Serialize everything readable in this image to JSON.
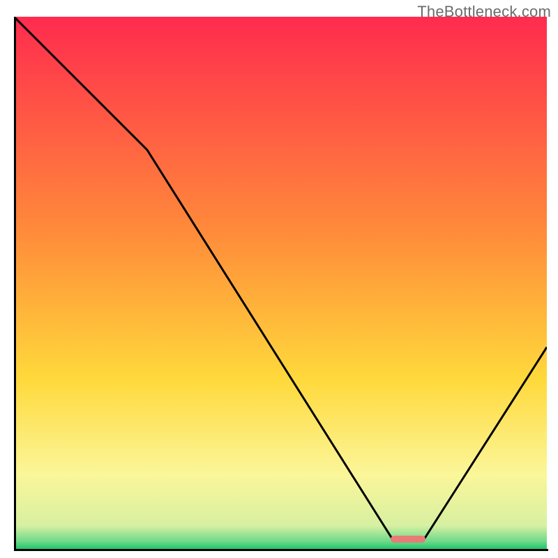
{
  "watermark": "TheBottleneck.com",
  "chart_data": {
    "type": "line",
    "title": "",
    "xlabel": "",
    "ylabel": "",
    "xlim": [
      0,
      100
    ],
    "ylim": [
      0,
      100
    ],
    "grid": false,
    "x": [
      0,
      25,
      71,
      77,
      100
    ],
    "values": [
      100,
      75,
      2,
      2,
      38
    ],
    "marker": {
      "x_start": 71,
      "x_end": 77,
      "y": 2,
      "color": "#e87a77"
    },
    "gradient_stops": [
      {
        "pos": 0.0,
        "color": "#ff2b4e"
      },
      {
        "pos": 0.4,
        "color": "#ff8a3a"
      },
      {
        "pos": 0.68,
        "color": "#ffd93b"
      },
      {
        "pos": 0.86,
        "color": "#fbf69a"
      },
      {
        "pos": 0.955,
        "color": "#d7f0a1"
      },
      {
        "pos": 0.985,
        "color": "#6cd989"
      },
      {
        "pos": 1.0,
        "color": "#17c36a"
      }
    ],
    "line_color": "#000000",
    "line_width": 3
  }
}
